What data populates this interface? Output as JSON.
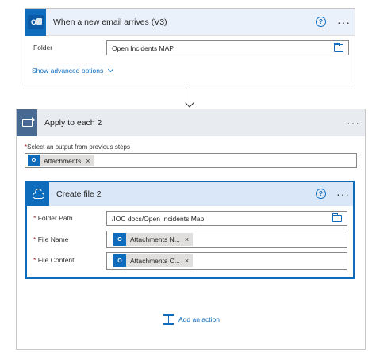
{
  "trigger": {
    "title": "When a new email arrives (V3)",
    "badge": "O",
    "help": "?",
    "more": "···",
    "folder_label": "Folder",
    "folder_value": "Open Incidents MAP",
    "advanced": "Show advanced options"
  },
  "apply": {
    "title": "Apply to each 2",
    "more": "···",
    "select_label": "Select an output from previous steps",
    "required_mark": "*",
    "token": "Attachments",
    "token_close": "×",
    "token_badge": "O"
  },
  "create": {
    "title": "Create file 2",
    "help": "?",
    "more": "···",
    "fields": [
      {
        "label": "Folder Path",
        "value": "/IOC docs/Open Incidents Map"
      },
      {
        "label": "File Name",
        "token": "Attachments N...",
        "close": "×",
        "badge": "O"
      },
      {
        "label": "File Content",
        "token": "Attachments C...",
        "close": "×",
        "badge": "O"
      }
    ]
  },
  "add_action": "Add an action",
  "colors": {
    "accent": "#0f6cbd",
    "loop_badge": "#486991",
    "trigger_header": "#eaf1fb",
    "create_header": "#d9e7f8"
  }
}
